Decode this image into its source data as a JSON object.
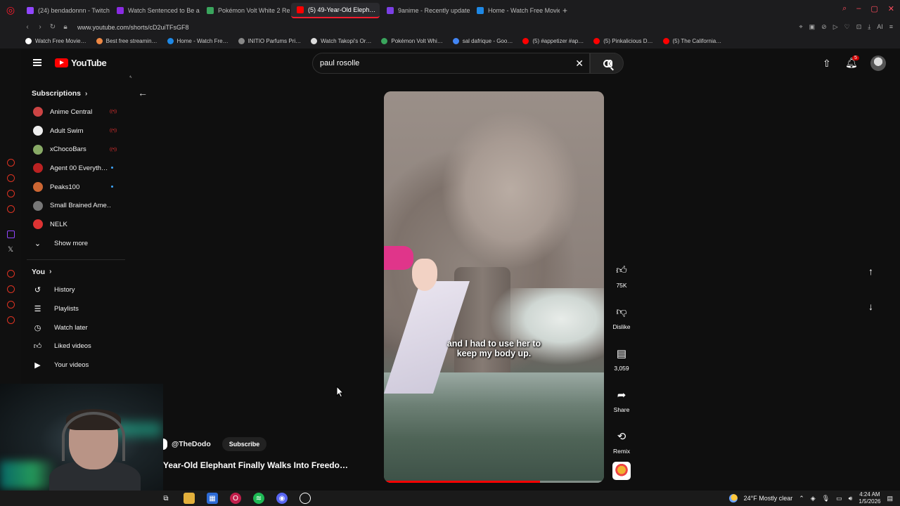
{
  "browser": {
    "tabs": [
      {
        "label": "(24) bendadonnn - Twitch",
        "color": "#9146ff"
      },
      {
        "label": "Watch Sentenced to Be a …",
        "color": "#8a2be2"
      },
      {
        "label": "Pokémon Volt White 2 Re…",
        "color": "#3aa55d"
      },
      {
        "label": "(5) 49-Year-Old Eleph…",
        "color": "#ff0000"
      },
      {
        "label": "9anime - Recently update…",
        "color": "#7b3fe4"
      },
      {
        "label": "Home - Watch Free Movie…",
        "color": "#1e88e5"
      }
    ],
    "active_tab_index": 3,
    "new_tab": "+",
    "url": "www.youtube.com/shorts/cD2uiTFsGF8",
    "bookmarks": [
      {
        "label": "Watch Free Movie…",
        "color": "#ffffff"
      },
      {
        "label": "Best free streamin…",
        "color": "#e84"
      },
      {
        "label": "Home - Watch Fre…",
        "color": "#1e88e5"
      },
      {
        "label": "INITIO Parfums Pri…",
        "color": "#888"
      },
      {
        "label": "Watch Takopi's Or…",
        "color": "#ddd"
      },
      {
        "label": "Pokémon Volt Whi…",
        "color": "#3aa55d"
      },
      {
        "label": "sal dafrique - Goo…",
        "color": "#4285f4"
      },
      {
        "label": "(5) #appetizer #ap…",
        "color": "#ff0000"
      },
      {
        "label": "(5) Pinkalicious D…",
        "color": "#ff0000"
      },
      {
        "label": "(5) The California…",
        "color": "#ff0000"
      }
    ]
  },
  "youtube": {
    "logo_text": "YouTube",
    "search_query": "paul rosolle",
    "notification_count": "5",
    "sidebar": {
      "subscriptions_title": "Subscriptions",
      "subscriptions": [
        {
          "name": "Anime Central",
          "status": "live",
          "color": "#c44"
        },
        {
          "name": "Adult Swim",
          "status": "live",
          "color": "#eee"
        },
        {
          "name": "xChocoBars",
          "status": "live",
          "color": "#8a6"
        },
        {
          "name": "Agent 00 Everyth…",
          "status": "new",
          "color": "#b22"
        },
        {
          "name": "Peaks100",
          "status": "new",
          "color": "#c63"
        },
        {
          "name": "Small Brained Ame…",
          "status": "",
          "color": "#777"
        },
        {
          "name": "NELK",
          "status": "",
          "color": "#d33"
        }
      ],
      "show_more": "Show more",
      "you_title": "You",
      "you_items": [
        "History",
        "Playlists",
        "Watch later",
        "Liked videos",
        "Your videos"
      ]
    },
    "short": {
      "caption_line1": "and I had to use her to",
      "caption_line2": "keep my body up.",
      "channel": "@TheDodo",
      "subscribe": "Subscribe",
      "title": "Year-Old Elephant Finally Walks Into Freedo…",
      "progress": 0.71
    },
    "actions": {
      "likes": "75K",
      "dislike": "Dislike",
      "comments": "3,059",
      "share": "Share",
      "remix": "Remix"
    }
  },
  "taskbar": {
    "weather": "24°F  Mostly clear",
    "time": "4:24 AM",
    "date": "1/5/2026"
  }
}
